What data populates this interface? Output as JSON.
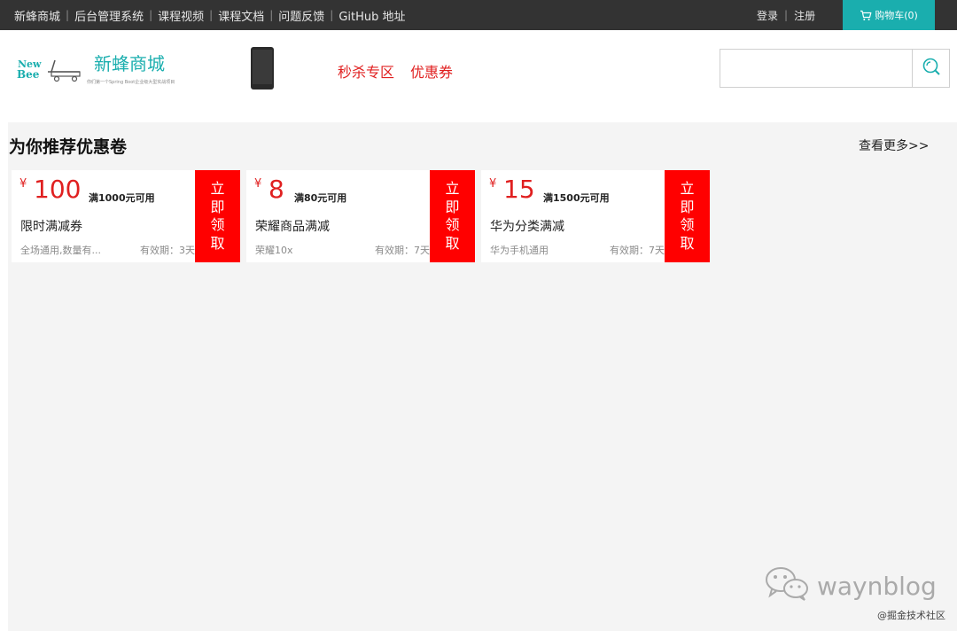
{
  "topbar": {
    "links": [
      "新蜂商城",
      "后台管理系统",
      "课程视频",
      "课程文档",
      "问题反馈",
      "GitHub 地址"
    ],
    "login": "登录",
    "register": "注册",
    "cart_label": "购物车(0)"
  },
  "header": {
    "logo_line1": "New",
    "logo_line2": "Bee",
    "site_name": "新蜂商城",
    "slogan": "你们第一个Spring Boot企业级大型实战项目",
    "nav": [
      "秒杀专区",
      "优惠券"
    ],
    "search_placeholder": ""
  },
  "section": {
    "title": "为你推荐优惠卷",
    "more": "查看更多>>"
  },
  "coupons": [
    {
      "currency": "¥",
      "amount": "100",
      "condition": "满1000元可用",
      "name": "限时满减券",
      "scope": "全场通用,数量有...",
      "validity": "有效期：3天",
      "claim": [
        "立",
        "即",
        "领",
        "取"
      ]
    },
    {
      "currency": "¥",
      "amount": "8",
      "condition": "满80元可用",
      "name": "荣耀商品满减",
      "scope": "荣耀10x",
      "validity": "有效期：7天",
      "claim": [
        "立",
        "即",
        "领",
        "取"
      ]
    },
    {
      "currency": "¥",
      "amount": "15",
      "condition": "满1500元可用",
      "name": "华为分类满减",
      "scope": "华为手机通用",
      "validity": "有效期：7天",
      "claim": [
        "立",
        "即",
        "领",
        "取"
      ]
    }
  ],
  "watermark": {
    "text": "waynblog",
    "community": "@掘金技术社区"
  },
  "colors": {
    "accent": "#1aaeae",
    "red": "#ff0000",
    "topbar": "#333333",
    "background": "#f4f4f4"
  }
}
